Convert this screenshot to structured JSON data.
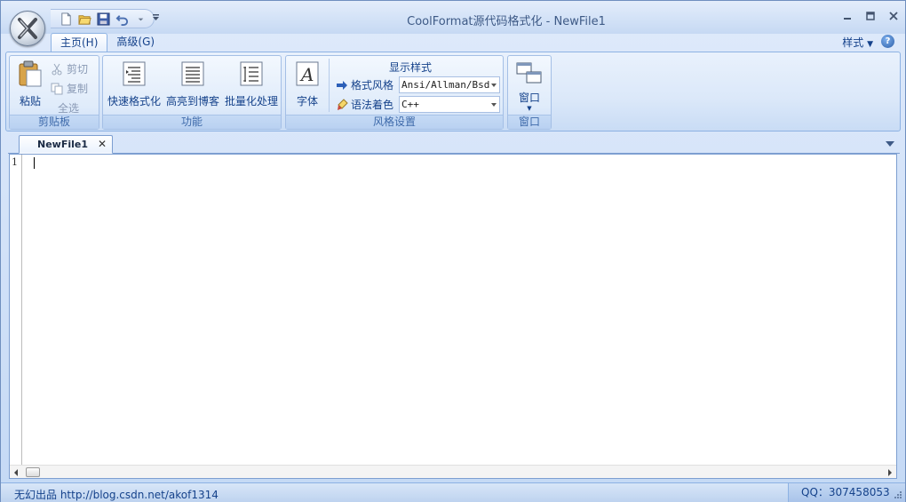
{
  "window": {
    "title": "CoolFormat源代码格式化 - NewFile1"
  },
  "ribbon": {
    "tabs": [
      {
        "label": "主页(H)",
        "active": true
      },
      {
        "label": "高级(G)",
        "active": false
      }
    ],
    "style_menu": "样式",
    "groups": {
      "clipboard": {
        "label": "剪贴板",
        "paste": "粘贴",
        "cut": "剪切",
        "copy": "复制",
        "select_all": "全选"
      },
      "function": {
        "label": "功能",
        "quick_format": "快速格式化",
        "highlight_blog": "高亮到博客",
        "batch": "批量化处理"
      },
      "style": {
        "label": "风格设置",
        "font": "字体",
        "display_style": "显示样式",
        "format_style_label": "格式风格",
        "format_style_value": "Ansi/Allman/Bsd",
        "syntax_color_label": "语法着色",
        "syntax_color_value": "C++"
      },
      "window": {
        "label": "窗口",
        "window_btn": "窗口"
      }
    }
  },
  "document": {
    "tab_name": "NewFile1",
    "line_numbers": [
      "1"
    ]
  },
  "statusbar": {
    "left": "无幻出品 http://blog.csdn.net/akof1314",
    "right": "QQ：307458053"
  }
}
